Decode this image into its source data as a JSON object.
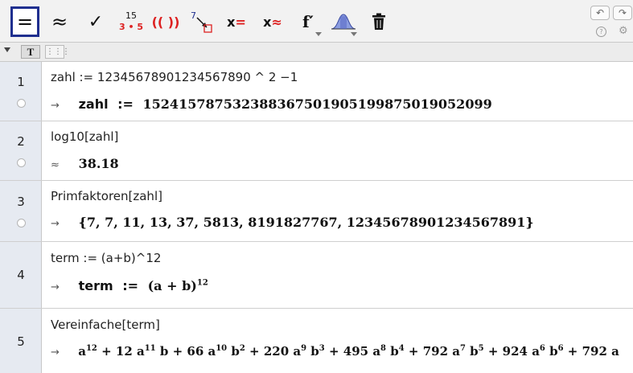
{
  "toolbar": {
    "tools": [
      {
        "name": "evaluate",
        "glyph": "="
      },
      {
        "name": "numeric",
        "glyph": "≈"
      },
      {
        "name": "keep-input",
        "glyph": "✓"
      },
      {
        "name": "factor",
        "top": "15",
        "bottom": "3 • 5"
      },
      {
        "name": "expand",
        "glyph": "(( ))"
      },
      {
        "name": "substitute",
        "glyph": "7"
      },
      {
        "name": "solve",
        "glyph": "x="
      },
      {
        "name": "solve-numerically",
        "glyph": "x≈"
      },
      {
        "name": "derivative",
        "glyph": "f′"
      },
      {
        "name": "probability-calculator",
        "glyph": ""
      },
      {
        "name": "delete",
        "glyph": ""
      }
    ],
    "undo_glyph": "↶",
    "redo_glyph": "↷",
    "help_glyph": "?",
    "settings_glyph": "⚙"
  },
  "subbar": {
    "text_style_label": "T"
  },
  "rows": [
    {
      "num": "1",
      "input": "zahl := 12345678901234567890 ^ 2 −1",
      "symbol": "→",
      "output_lhs": "zahl",
      "output_op": ":=",
      "output_rhs": "152415787532388367501905199875019052099"
    },
    {
      "num": "2",
      "input": "log10[zahl]",
      "symbol": "≈",
      "output": "38.18"
    },
    {
      "num": "3",
      "input": "Primfaktoren[zahl]",
      "symbol": "→",
      "output": "{7, 7, 11, 13, 37, 5813, 8191827767, 12345678901234567891}"
    },
    {
      "num": "4",
      "input": "term := (a+b)^12",
      "symbol": "→",
      "output_lhs": "term",
      "output_op": ":=",
      "output_base": "(a + b)",
      "output_exp": "12"
    },
    {
      "num": "5",
      "input": "Vereinfache[term]",
      "symbol": "→",
      "terms": [
        {
          "coef": "",
          "a": "12",
          "b": ""
        },
        {
          "coef": "12",
          "a": "11",
          "b": "1"
        },
        {
          "coef": "66",
          "a": "10",
          "b": "2"
        },
        {
          "coef": "220",
          "a": "9",
          "b": "3"
        },
        {
          "coef": "495",
          "a": "8",
          "b": "4"
        },
        {
          "coef": "792",
          "a": "7",
          "b": "5"
        },
        {
          "coef": "924",
          "a": "6",
          "b": "6"
        },
        {
          "coef": "792",
          "a": "",
          "b": ""
        }
      ]
    }
  ]
}
